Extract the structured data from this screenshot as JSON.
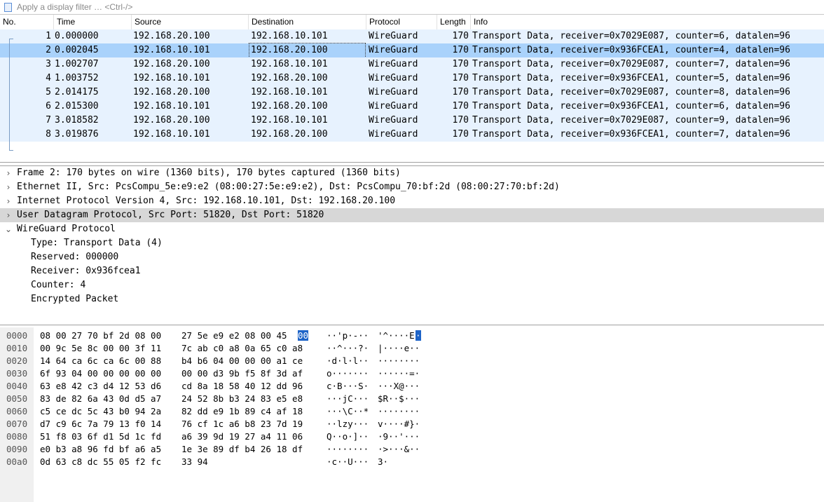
{
  "filter": {
    "placeholder": "Apply a display filter … <Ctrl-/>"
  },
  "packet_list": {
    "columns": [
      "No.",
      "Time",
      "Source",
      "Destination",
      "Protocol",
      "Length",
      "Info"
    ],
    "rows": [
      {
        "no": "1",
        "time": "0.000000",
        "src": "192.168.20.100",
        "dst": "192.168.10.101",
        "proto": "WireGuard",
        "len": "170",
        "info": "Transport Data, receiver=0x7029E087, counter=6, datalen=96"
      },
      {
        "no": "2",
        "time": "0.002045",
        "src": "192.168.10.101",
        "dst": "192.168.20.100",
        "proto": "WireGuard",
        "len": "170",
        "info": "Transport Data, receiver=0x936FCEA1, counter=4, datalen=96"
      },
      {
        "no": "3",
        "time": "1.002707",
        "src": "192.168.20.100",
        "dst": "192.168.10.101",
        "proto": "WireGuard",
        "len": "170",
        "info": "Transport Data, receiver=0x7029E087, counter=7, datalen=96"
      },
      {
        "no": "4",
        "time": "1.003752",
        "src": "192.168.10.101",
        "dst": "192.168.20.100",
        "proto": "WireGuard",
        "len": "170",
        "info": "Transport Data, receiver=0x936FCEA1, counter=5, datalen=96"
      },
      {
        "no": "5",
        "time": "2.014175",
        "src": "192.168.20.100",
        "dst": "192.168.10.101",
        "proto": "WireGuard",
        "len": "170",
        "info": "Transport Data, receiver=0x7029E087, counter=8, datalen=96"
      },
      {
        "no": "6",
        "time": "2.015300",
        "src": "192.168.10.101",
        "dst": "192.168.20.100",
        "proto": "WireGuard",
        "len": "170",
        "info": "Transport Data, receiver=0x936FCEA1, counter=6, datalen=96"
      },
      {
        "no": "7",
        "time": "3.018582",
        "src": "192.168.20.100",
        "dst": "192.168.10.101",
        "proto": "WireGuard",
        "len": "170",
        "info": "Transport Data, receiver=0x7029E087, counter=9, datalen=96"
      },
      {
        "no": "8",
        "time": "3.019876",
        "src": "192.168.10.101",
        "dst": "192.168.20.100",
        "proto": "WireGuard",
        "len": "170",
        "info": "Transport Data, receiver=0x936FCEA1, counter=7, datalen=96"
      }
    ],
    "selected_row": 2
  },
  "details": [
    {
      "text": "Frame 2: 170 bytes on wire (1360 bits), 170 bytes captured (1360 bits)",
      "expander": "›",
      "indent": 0,
      "highlight": false
    },
    {
      "text": "Ethernet II, Src: PcsCompu_5e:e9:e2 (08:00:27:5e:e9:e2), Dst: PcsCompu_70:bf:2d (08:00:27:70:bf:2d)",
      "expander": "›",
      "indent": 0,
      "highlight": false
    },
    {
      "text": "Internet Protocol Version 4, Src: 192.168.10.101, Dst: 192.168.20.100",
      "expander": "›",
      "indent": 0,
      "highlight": false
    },
    {
      "text": "User Datagram Protocol, Src Port: 51820, Dst Port: 51820",
      "expander": "›",
      "indent": 0,
      "highlight": true
    },
    {
      "text": "WireGuard Protocol",
      "expander": "⌄",
      "indent": 0,
      "highlight": false
    },
    {
      "text": "Type: Transport Data (4)",
      "expander": "",
      "indent": 1,
      "highlight": false
    },
    {
      "text": "Reserved: 000000",
      "expander": "",
      "indent": 1,
      "highlight": false
    },
    {
      "text": "Receiver: 0x936fcea1",
      "expander": "",
      "indent": 1,
      "highlight": false
    },
    {
      "text": "Counter: 4",
      "expander": "",
      "indent": 1,
      "highlight": false
    },
    {
      "text": "Encrypted Packet",
      "expander": "",
      "indent": 1,
      "highlight": false
    }
  ],
  "bytes": [
    {
      "off": "0000",
      "hex1": "08 00 27 70 bf 2d 08 00",
      "hex2": "27 5e e9 e2 08 00 45",
      "sel_hex": "00",
      "asc1": "··'p·-··",
      "asc2": "'^····E",
      "sel_asc": "·"
    },
    {
      "off": "0010",
      "hex1": "00 9c 5e 8c 00 00 3f 11",
      "hex2": "7c ab c0 a8 0a 65 c0 a8",
      "sel_hex": "",
      "asc1": "··^···?·",
      "asc2": "|····e··",
      "sel_asc": ""
    },
    {
      "off": "0020",
      "hex1": "14 64 ca 6c ca 6c 00 88",
      "hex2": "b4 b6 04 00 00 00 a1 ce",
      "sel_hex": "",
      "asc1": "·d·l·l··",
      "asc2": "········",
      "sel_asc": ""
    },
    {
      "off": "0030",
      "hex1": "6f 93 04 00 00 00 00 00",
      "hex2": "00 00 d3 9b f5 8f 3d af",
      "sel_hex": "",
      "asc1": "o·······",
      "asc2": "······=·",
      "sel_asc": ""
    },
    {
      "off": "0040",
      "hex1": "63 e8 42 c3 d4 12 53 d6",
      "hex2": "cd 8a 18 58 40 12 dd 96",
      "sel_hex": "",
      "asc1": "c·B···S·",
      "asc2": "···X@···",
      "sel_asc": ""
    },
    {
      "off": "0050",
      "hex1": "83 de 82 6a 43 0d d5 a7",
      "hex2": "24 52 8b b3 24 83 e5 e8",
      "sel_hex": "",
      "asc1": "···jC···",
      "asc2": "$R··$···",
      "sel_asc": ""
    },
    {
      "off": "0060",
      "hex1": "c5 ce dc 5c 43 b0 94 2a",
      "hex2": "82 dd e9 1b 89 c4 af 18",
      "sel_hex": "",
      "asc1": "···\\C··*",
      "asc2": "········",
      "sel_asc": ""
    },
    {
      "off": "0070",
      "hex1": "d7 c9 6c 7a 79 13 f0 14",
      "hex2": "76 cf 1c a6 b8 23 7d 19",
      "sel_hex": "",
      "asc1": "··lzy···",
      "asc2": "v····#}·",
      "sel_asc": ""
    },
    {
      "off": "0080",
      "hex1": "51 f8 03 6f d1 5d 1c fd",
      "hex2": "a6 39 9d 19 27 a4 11 06",
      "sel_hex": "",
      "asc1": "Q··o·]··",
      "asc2": "·9··'···",
      "sel_asc": ""
    },
    {
      "off": "0090",
      "hex1": "e0 b3 a8 96 fd bf a6 a5",
      "hex2": "1e 3e 89 df b4 26 18 df",
      "sel_hex": "",
      "asc1": "········",
      "asc2": "·>···&··",
      "sel_asc": ""
    },
    {
      "off": "00a0",
      "hex1": "0d 63 c8 dc 55 05 f2 fc",
      "hex2": "33 94",
      "sel_hex": "",
      "asc1": "·c··U···",
      "asc2": "3·",
      "sel_asc": ""
    }
  ],
  "colors": {
    "row": "#e7f2fe",
    "selected": "#a9d2fb",
    "detail_highlight": "#d7d7d7",
    "byte_selection": "#1e64c8"
  }
}
